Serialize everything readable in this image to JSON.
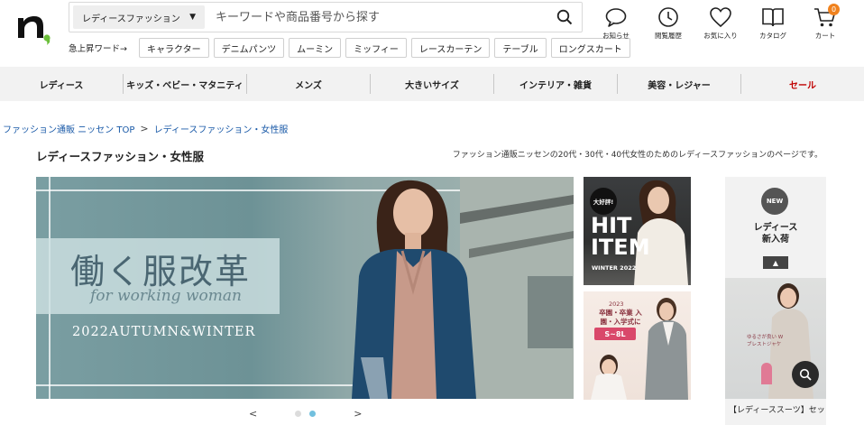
{
  "header": {
    "search": {
      "category": "レディースファッション",
      "placeholder": "キーワードや商品番号から探す"
    },
    "trending": {
      "label": "急上昇ワード→",
      "tags": [
        "キャラクター",
        "デニムパンツ",
        "ムーミン",
        "ミッフィー",
        "レースカーテン",
        "テーブル",
        "ロングスカート"
      ]
    },
    "icons": [
      {
        "label": "お知らせ",
        "icon": "speech-bubble-icon"
      },
      {
        "label": "閲覧履歴",
        "icon": "clock-icon"
      },
      {
        "label": "お気に入り",
        "icon": "heart-icon"
      },
      {
        "label": "カタログ",
        "icon": "book-icon"
      },
      {
        "label": "カート",
        "icon": "cart-icon",
        "badge": "0"
      }
    ]
  },
  "nav": {
    "items": [
      "レディース",
      "キッズ・ベビー・マタニティ",
      "メンズ",
      "大きいサイズ",
      "インテリア・雑貨",
      "美容・レジャー",
      "セール"
    ]
  },
  "breadcrumb": {
    "home": "ファッション通販 ニッセン TOP",
    "separator": ">",
    "current": "レディースファッション・女性服"
  },
  "page": {
    "title": "レディースファッション・女性服",
    "description": "ファッション通販ニッセンの20代・30代・40代女性のためのレディースファッションのページです。"
  },
  "hero": {
    "title": "働く服改革",
    "script": "for working woman",
    "season": "2022AUTUMN&WINTER",
    "prev": "<",
    "next": ">",
    "active_slide": 2,
    "slide_count": 2
  },
  "promos": [
    {
      "badge": "大好評!",
      "title": "HIT ITEM",
      "sub": "WINTER 2022"
    },
    {
      "line1": "2023",
      "line2": "卒園・卒業 入園・入学式に",
      "size": "S~8L"
    }
  ],
  "side": {
    "badge": "NEW",
    "title_line1": "レディース",
    "title_line2": "新入荷",
    "up_icon": "chevron-up-icon",
    "image_text": "ゆるさが良い Wブレストジャケ",
    "caption": "【レディーススーツ】セッ"
  },
  "colors": {
    "accent_orange": "#f0821e",
    "sale_red": "#c00000",
    "link_blue": "#1a5aa8",
    "dot_active": "#72c0de"
  }
}
